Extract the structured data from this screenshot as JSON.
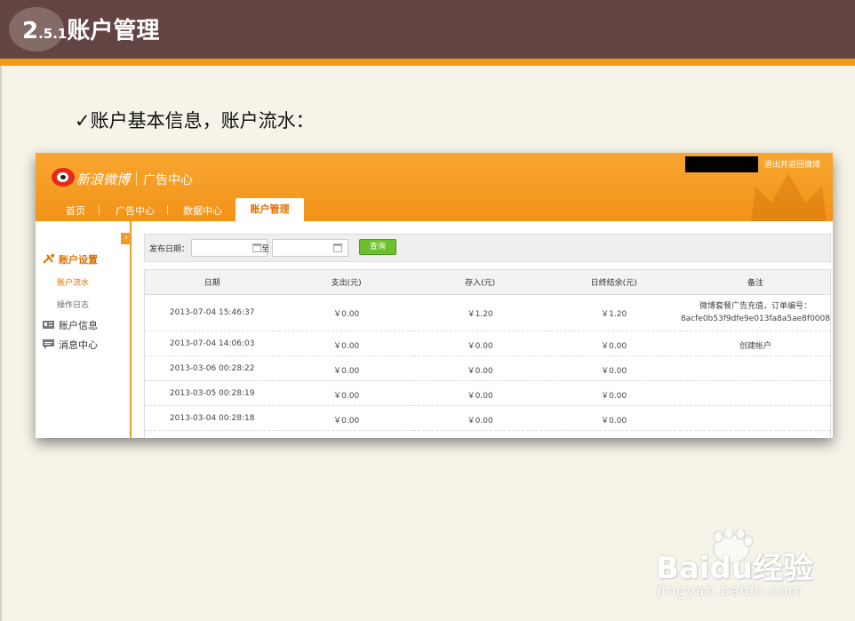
{
  "slide": {
    "section_number_big": "2",
    "section_number_small": ".5.1",
    "section_title": "账户管理",
    "bullet": "✓账户基本信息，账户流水："
  },
  "weibo": {
    "brand": "新浪微博",
    "brand_sub": "广告中心",
    "exit_link": "退出并返回微博",
    "nav": [
      "首页",
      "广告中心",
      "数据中心"
    ],
    "nav_active": "账户管理"
  },
  "sidebar": {
    "collapse_icon": "‹",
    "groups": [
      {
        "label": "账户设置",
        "icon": "wrench-icon",
        "active": true
      },
      {
        "label": "账户信息",
        "icon": "id-card-icon",
        "active": false
      },
      {
        "label": "消息中心",
        "icon": "message-icon",
        "active": false
      }
    ],
    "subitems": [
      {
        "label": "账户流水",
        "active": true
      },
      {
        "label": "操作日志",
        "active": false
      }
    ]
  },
  "filter": {
    "label": "发布日期：",
    "start_value": "",
    "to": "至",
    "end_value": "",
    "query_button": "查询"
  },
  "table": {
    "headers": [
      "日期",
      "支出(元)",
      "存入(元)",
      "日终结余(元)",
      "备注"
    ],
    "rows": [
      {
        "date": "2013-07-04 15:46:37",
        "out": "￥0.00",
        "in": "￥1.20",
        "balance": "￥1.20",
        "note_line1": "微博套餐广告充值，订单编号：",
        "note_line2": "8acfe0b53f9dfe9e013fa8a5ae8f0008"
      },
      {
        "date": "2013-07-04 14:06:03",
        "out": "￥0.00",
        "in": "￥0.00",
        "balance": "￥0.00",
        "note_line1": "创建帐户",
        "note_line2": ""
      },
      {
        "date": "2013-03-06 00:28:22",
        "out": "￥0.00",
        "in": "￥0.00",
        "balance": "￥0.00",
        "note_line1": "",
        "note_line2": ""
      },
      {
        "date": "2013-03-05 00:28:19",
        "out": "￥0.00",
        "in": "￥0.00",
        "balance": "￥0.00",
        "note_line1": "",
        "note_line2": ""
      },
      {
        "date": "2013-03-04 00:28:18",
        "out": "￥0.00",
        "in": "￥0.00",
        "balance": "￥0.00",
        "note_line1": "",
        "note_line2": ""
      }
    ]
  },
  "watermark": {
    "logo": "Baidu经验",
    "url": "jingyan.baidu.com"
  },
  "colors": {
    "header_brown": "#624543",
    "accent_orange": "#f39a1a",
    "slide_bg": "#f6f4e8",
    "query_green": "#6cbf2e"
  }
}
